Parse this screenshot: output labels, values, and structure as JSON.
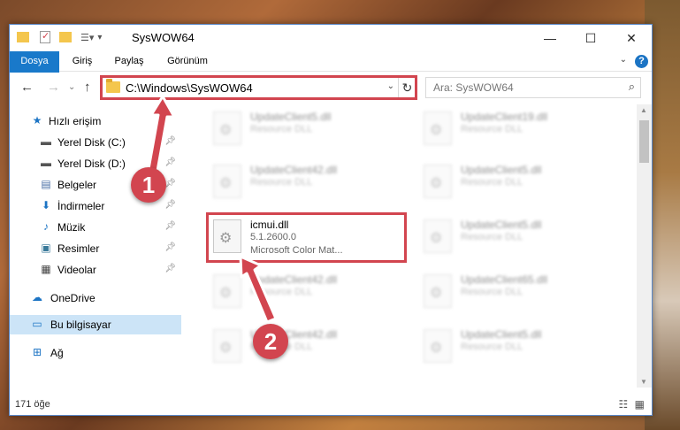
{
  "window": {
    "title": "SysWOW64",
    "minimize": "—",
    "maximize": "☐",
    "close": "✕"
  },
  "ribbon": {
    "tabs": [
      "Dosya",
      "Giriş",
      "Paylaş",
      "Görünüm"
    ],
    "help": "?"
  },
  "address": {
    "path": "C:\\Windows\\SysWOW64",
    "search_placeholder": "Ara: SysWOW64"
  },
  "nav": {
    "items": [
      {
        "label": "Hızlı erişim",
        "icon": "star-icon"
      },
      {
        "label": "Yerel Disk (C:)",
        "icon": "drive-icon"
      },
      {
        "label": "Yerel Disk (D:)",
        "icon": "drive-icon"
      },
      {
        "label": "Belgeler",
        "icon": "documents-icon"
      },
      {
        "label": "İndirmeler",
        "icon": "download-icon"
      },
      {
        "label": "Müzik",
        "icon": "music-icon"
      },
      {
        "label": "Resimler",
        "icon": "pictures-icon"
      },
      {
        "label": "Videolar",
        "icon": "video-icon"
      },
      {
        "label": "OneDrive",
        "icon": "cloud-icon"
      },
      {
        "label": "Bu bilgisayar",
        "icon": "computer-icon"
      },
      {
        "label": "Ağ",
        "icon": "network-icon"
      }
    ]
  },
  "files": {
    "highlighted": {
      "name": "icmui.dll",
      "version": "5.1.2600.0",
      "description": "Microsoft Color Mat..."
    },
    "blurred": [
      {
        "name": "UpdateClient5.dll",
        "type": "Resource DLL"
      },
      {
        "name": "UpdateClient19.dll",
        "type": "Resource DLL"
      },
      {
        "name": "UpdateClient42.dll",
        "type": "Resource DLL"
      },
      {
        "name": "UpdateClient5.dll",
        "type": "Resource DLL"
      },
      {
        "name": "UpdateClient5.dll",
        "type": "Resource DLL"
      },
      {
        "name": "UpdateClient42.dll",
        "type": "Resource DLL"
      },
      {
        "name": "UpdateClient65.dll",
        "type": "Resource DLL"
      },
      {
        "name": "UpdateClient42.dll",
        "type": "Resource DLL"
      },
      {
        "name": "UpdateClient5.dll",
        "type": "Resource DLL"
      }
    ]
  },
  "status": {
    "count": "171 öğe"
  },
  "annotations": {
    "step1": "1",
    "step2": "2",
    "color": "#d2454f"
  }
}
